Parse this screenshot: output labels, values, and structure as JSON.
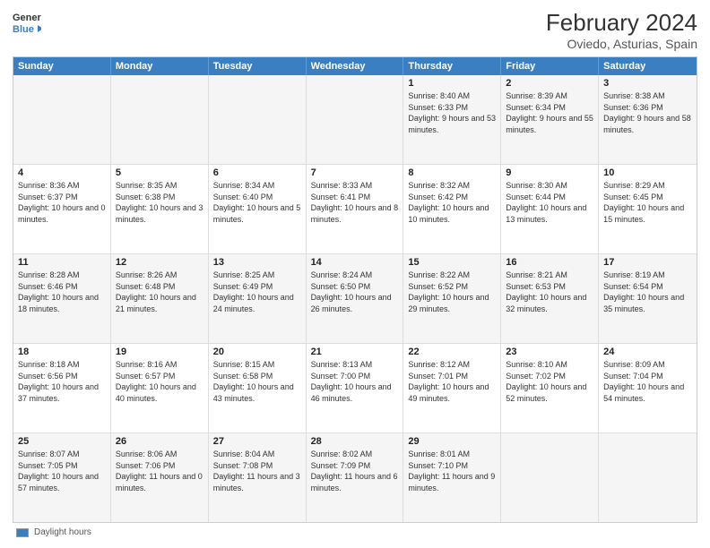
{
  "header": {
    "logo_general": "General",
    "logo_blue": "Blue",
    "title": "February 2024",
    "subtitle": "Oviedo, Asturias, Spain"
  },
  "days": [
    "Sunday",
    "Monday",
    "Tuesday",
    "Wednesday",
    "Thursday",
    "Friday",
    "Saturday"
  ],
  "rows": [
    [
      {
        "date": "",
        "info": ""
      },
      {
        "date": "",
        "info": ""
      },
      {
        "date": "",
        "info": ""
      },
      {
        "date": "",
        "info": ""
      },
      {
        "date": "1",
        "info": "Sunrise: 8:40 AM\nSunset: 6:33 PM\nDaylight: 9 hours\nand 53 minutes."
      },
      {
        "date": "2",
        "info": "Sunrise: 8:39 AM\nSunset: 6:34 PM\nDaylight: 9 hours\nand 55 minutes."
      },
      {
        "date": "3",
        "info": "Sunrise: 8:38 AM\nSunset: 6:36 PM\nDaylight: 9 hours\nand 58 minutes."
      }
    ],
    [
      {
        "date": "4",
        "info": "Sunrise: 8:36 AM\nSunset: 6:37 PM\nDaylight: 10 hours\nand 0 minutes."
      },
      {
        "date": "5",
        "info": "Sunrise: 8:35 AM\nSunset: 6:38 PM\nDaylight: 10 hours\nand 3 minutes."
      },
      {
        "date": "6",
        "info": "Sunrise: 8:34 AM\nSunset: 6:40 PM\nDaylight: 10 hours\nand 5 minutes."
      },
      {
        "date": "7",
        "info": "Sunrise: 8:33 AM\nSunset: 6:41 PM\nDaylight: 10 hours\nand 8 minutes."
      },
      {
        "date": "8",
        "info": "Sunrise: 8:32 AM\nSunset: 6:42 PM\nDaylight: 10 hours\nand 10 minutes."
      },
      {
        "date": "9",
        "info": "Sunrise: 8:30 AM\nSunset: 6:44 PM\nDaylight: 10 hours\nand 13 minutes."
      },
      {
        "date": "10",
        "info": "Sunrise: 8:29 AM\nSunset: 6:45 PM\nDaylight: 10 hours\nand 15 minutes."
      }
    ],
    [
      {
        "date": "11",
        "info": "Sunrise: 8:28 AM\nSunset: 6:46 PM\nDaylight: 10 hours\nand 18 minutes."
      },
      {
        "date": "12",
        "info": "Sunrise: 8:26 AM\nSunset: 6:48 PM\nDaylight: 10 hours\nand 21 minutes."
      },
      {
        "date": "13",
        "info": "Sunrise: 8:25 AM\nSunset: 6:49 PM\nDaylight: 10 hours\nand 24 minutes."
      },
      {
        "date": "14",
        "info": "Sunrise: 8:24 AM\nSunset: 6:50 PM\nDaylight: 10 hours\nand 26 minutes."
      },
      {
        "date": "15",
        "info": "Sunrise: 8:22 AM\nSunset: 6:52 PM\nDaylight: 10 hours\nand 29 minutes."
      },
      {
        "date": "16",
        "info": "Sunrise: 8:21 AM\nSunset: 6:53 PM\nDaylight: 10 hours\nand 32 minutes."
      },
      {
        "date": "17",
        "info": "Sunrise: 8:19 AM\nSunset: 6:54 PM\nDaylight: 10 hours\nand 35 minutes."
      }
    ],
    [
      {
        "date": "18",
        "info": "Sunrise: 8:18 AM\nSunset: 6:56 PM\nDaylight: 10 hours\nand 37 minutes."
      },
      {
        "date": "19",
        "info": "Sunrise: 8:16 AM\nSunset: 6:57 PM\nDaylight: 10 hours\nand 40 minutes."
      },
      {
        "date": "20",
        "info": "Sunrise: 8:15 AM\nSunset: 6:58 PM\nDaylight: 10 hours\nand 43 minutes."
      },
      {
        "date": "21",
        "info": "Sunrise: 8:13 AM\nSunset: 7:00 PM\nDaylight: 10 hours\nand 46 minutes."
      },
      {
        "date": "22",
        "info": "Sunrise: 8:12 AM\nSunset: 7:01 PM\nDaylight: 10 hours\nand 49 minutes."
      },
      {
        "date": "23",
        "info": "Sunrise: 8:10 AM\nSunset: 7:02 PM\nDaylight: 10 hours\nand 52 minutes."
      },
      {
        "date": "24",
        "info": "Sunrise: 8:09 AM\nSunset: 7:04 PM\nDaylight: 10 hours\nand 54 minutes."
      }
    ],
    [
      {
        "date": "25",
        "info": "Sunrise: 8:07 AM\nSunset: 7:05 PM\nDaylight: 10 hours\nand 57 minutes."
      },
      {
        "date": "26",
        "info": "Sunrise: 8:06 AM\nSunset: 7:06 PM\nDaylight: 11 hours\nand 0 minutes."
      },
      {
        "date": "27",
        "info": "Sunrise: 8:04 AM\nSunset: 7:08 PM\nDaylight: 11 hours\nand 3 minutes."
      },
      {
        "date": "28",
        "info": "Sunrise: 8:02 AM\nSunset: 7:09 PM\nDaylight: 11 hours\nand 6 minutes."
      },
      {
        "date": "29",
        "info": "Sunrise: 8:01 AM\nSunset: 7:10 PM\nDaylight: 11 hours\nand 9 minutes."
      },
      {
        "date": "",
        "info": ""
      },
      {
        "date": "",
        "info": ""
      }
    ]
  ],
  "footer": {
    "legend_label": "Daylight hours"
  }
}
